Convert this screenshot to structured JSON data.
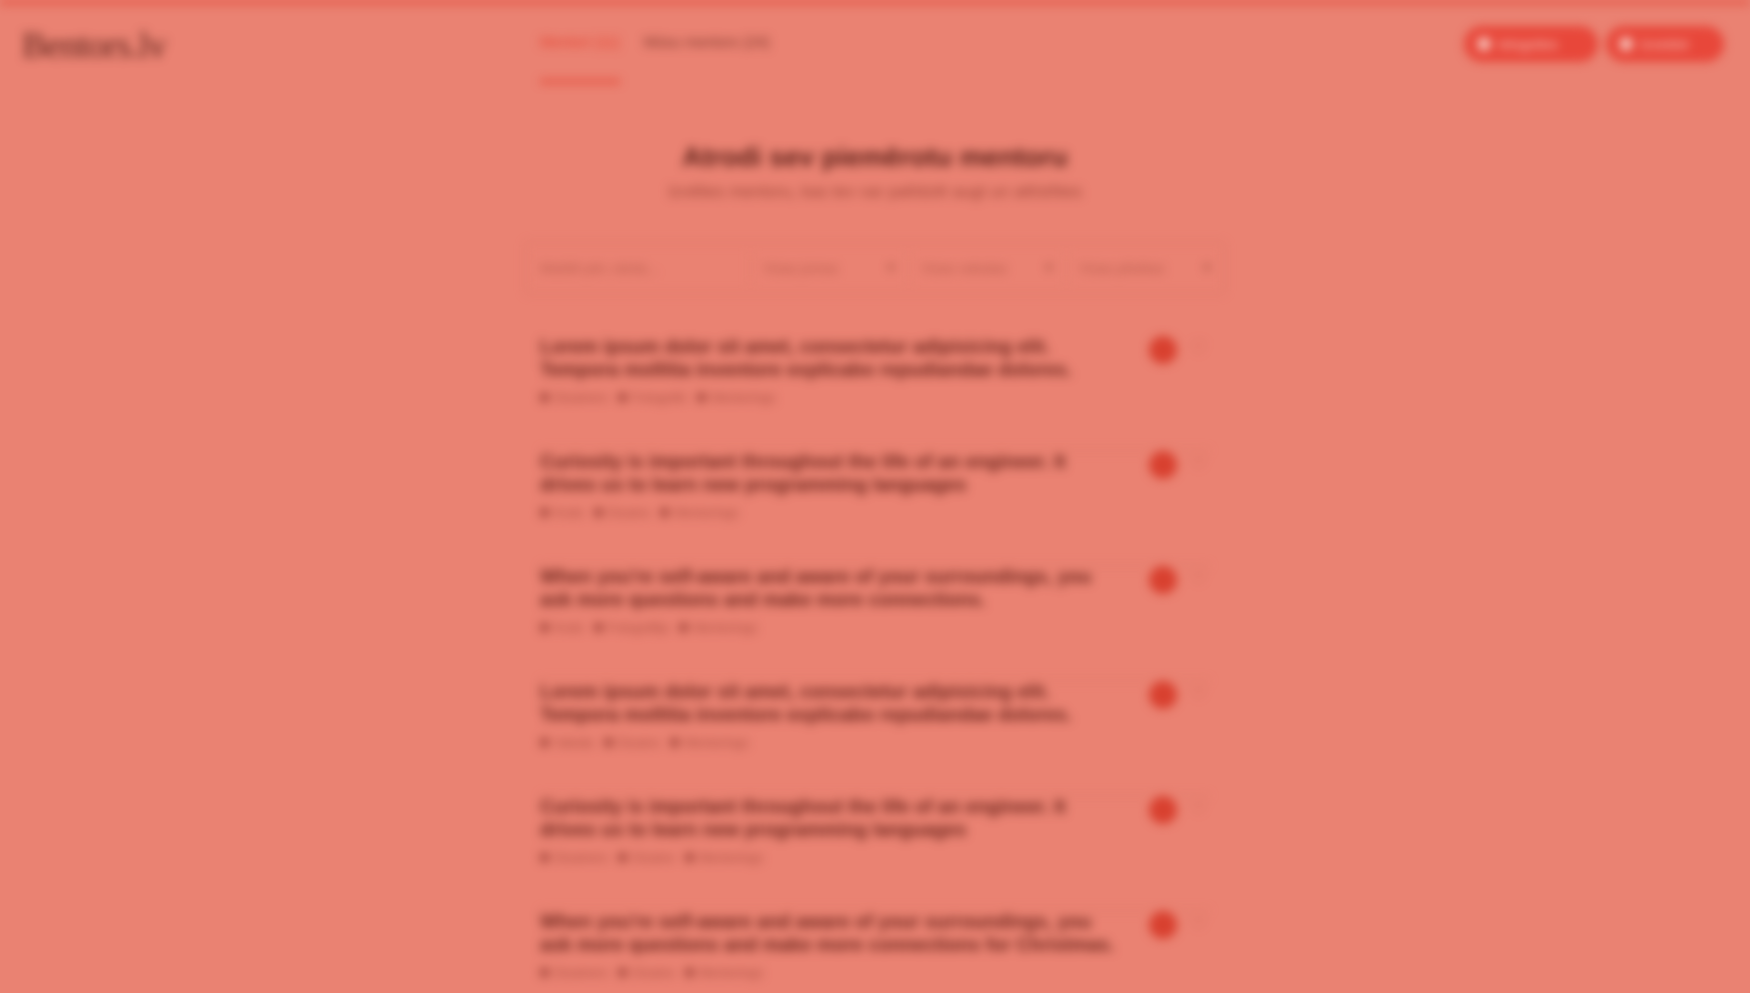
{
  "app": {
    "logo": "Bentors.lv",
    "colors": {
      "background": "#ea8272",
      "accent": "#e63b2a"
    }
  },
  "header": {
    "tabs": [
      {
        "label": "Mentori (11)",
        "active": true
      },
      {
        "label": "Mūsu mentors (24)",
        "active": false
      }
    ],
    "buttons": [
      {
        "label": "Ielogoties",
        "icon": "user-icon"
      },
      {
        "label": "Izveidot",
        "icon": "plus-icon"
      }
    ]
  },
  "hero": {
    "title": "Atrodi sev piemērotu mentoru",
    "subtitle": "Izvēlies mentoru, kas tev var palīdzēt augt un attīstīties"
  },
  "filters": {
    "search_placeholder": "Meklēt pēc vārda...",
    "selects": [
      {
        "value": "Visas jomas",
        "icon": "chevron-down-icon"
      },
      {
        "value": "Visas valodas",
        "icon": "chevron-down-icon"
      },
      {
        "value": "Visas pilsētas",
        "icon": "chevron-down-icon"
      }
    ]
  },
  "mentors": [
    {
      "title": "Lorem ipsum dolor sit amet, consectetur adipisicing elit. Tempora mollitia inventore explicabo repudiandae dolores.",
      "tags": [
        "Dizainers",
        "Fotogrāfs",
        "Mentorings"
      ]
    },
    {
      "title": "Curiosity is important throughout the life of an engineer. It drives us to learn new programming languages",
      "tags": [
        "Kods",
        "Dizains",
        "Mentorings"
      ]
    },
    {
      "title": "When you're self-aware and aware of your surroundings, you ask more questions and make more connections.",
      "tags": [
        "Kods",
        "Fotogrāfija",
        "Mentorings"
      ]
    },
    {
      "title": "Lorem ipsum dolor sit amet, consectetur adipisicing elit. Tempora mollitia inventore explicabo repudiandae dolores.",
      "tags": [
        "Valoda",
        "Dizains",
        "Mentorings"
      ]
    },
    {
      "title": "Curiosity is important throughout the life of an engineer. It drives us to learn new programming languages",
      "tags": [
        "Dizainers",
        "Dizains",
        "Mentorings"
      ]
    },
    {
      "title": "When you're self-aware and aware of your surroundings, you ask more questions and make more connections for Christmas.",
      "tags": [
        "Dizainers",
        "Dizains",
        "Mentorings"
      ]
    }
  ]
}
